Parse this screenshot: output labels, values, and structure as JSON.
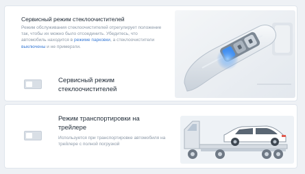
{
  "service_mode": {
    "title": "Сервисный режим стеклоочистителей",
    "description_part1": "Режим обслуживания стеклоочистителей отрегулирует положение так, чтобы их можно было отсоединить. Убедитесь, что автомобиль находится в ",
    "description_link1": "режиме парковки",
    "description_part2": ", а стеклоочистители ",
    "description_link2": "выключены",
    "description_part3": " и не примерзли.",
    "toggle_label": "Сервисный режим стеклоочистителей",
    "toggle_on": false,
    "illustration": "wiper-stalk-image"
  },
  "tow_mode": {
    "title": "Режим транспортировки на трейлере",
    "description": "Используется при транспортировке автомобиля на трейлере с полной погрузкой",
    "toggle_on": false,
    "illustration": "car-on-trailer-image"
  },
  "colors": {
    "background": "#eef1f5",
    "card": "#ffffff",
    "link": "#3a7bd5",
    "highlight": "#3f8df0",
    "text": "#1f2a36",
    "muted": "#8a97a6"
  }
}
